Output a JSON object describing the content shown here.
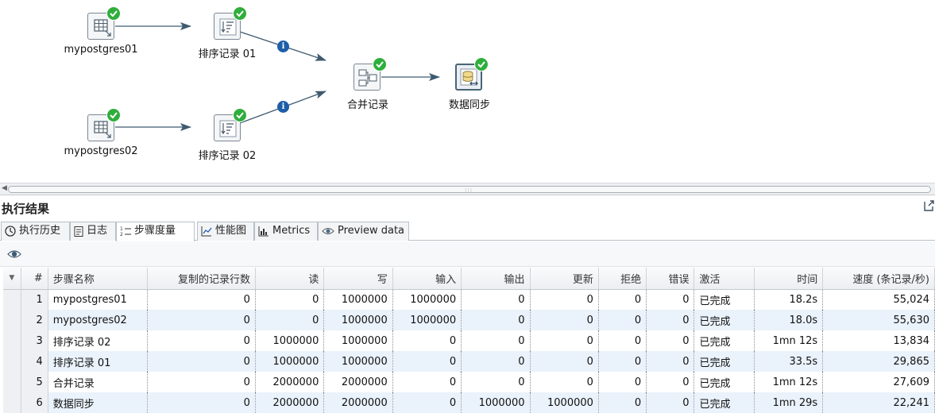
{
  "canvas": {
    "nodes": {
      "input1": {
        "label": "mypostgres01",
        "icon": "table-input-icon"
      },
      "input2": {
        "label": "mypostgres02",
        "icon": "table-input-icon"
      },
      "sort1": {
        "label": "排序记录 01",
        "icon": "sort-rows-icon"
      },
      "sort2": {
        "label": "排序记录 02",
        "icon": "sort-rows-icon"
      },
      "merge": {
        "label": "合并记录",
        "icon": "merge-rows-icon"
      },
      "sync": {
        "label": "数据同步",
        "icon": "sync-database-icon"
      }
    },
    "info_badge": "i",
    "colors": {
      "edge": "#3d5a70",
      "ok": "#2fae3c",
      "info": "#1e5ea8"
    }
  },
  "results": {
    "title": "执行结果",
    "tabs": [
      {
        "label": "执行历史",
        "icon": "history-icon"
      },
      {
        "label": "日志",
        "icon": "log-icon"
      },
      {
        "label": "步骤度量",
        "icon": "step-metrics-icon"
      },
      {
        "label": "性能图",
        "icon": "perf-graph-icon"
      },
      {
        "label": "Metrics",
        "icon": "metrics-icon"
      },
      {
        "label": "Preview data",
        "icon": "eye-icon"
      }
    ],
    "active_tab": "步骤度量",
    "table": {
      "columns": [
        "#",
        "步骤名称",
        "复制的记录行数",
        "读",
        "写",
        "输入",
        "输出",
        "更新",
        "拒绝",
        "错误",
        "激活",
        "时间",
        "速度 (条记录/秒)"
      ],
      "rows": [
        [
          "1",
          "mypostgres01",
          "0",
          "0",
          "1000000",
          "1000000",
          "0",
          "0",
          "0",
          "0",
          "已完成",
          "18.2s",
          "55,024"
        ],
        [
          "2",
          "mypostgres02",
          "0",
          "0",
          "1000000",
          "1000000",
          "0",
          "0",
          "0",
          "0",
          "已完成",
          "18.0s",
          "55,630"
        ],
        [
          "3",
          "排序记录 02",
          "0",
          "1000000",
          "1000000",
          "0",
          "0",
          "0",
          "0",
          "0",
          "已完成",
          "1mn 12s",
          "13,834"
        ],
        [
          "4",
          "排序记录 01",
          "0",
          "1000000",
          "1000000",
          "0",
          "0",
          "0",
          "0",
          "0",
          "已完成",
          "33.5s",
          "29,865"
        ],
        [
          "5",
          "合并记录",
          "0",
          "2000000",
          "2000000",
          "0",
          "0",
          "0",
          "0",
          "0",
          "已完成",
          "1mn 12s",
          "27,609"
        ],
        [
          "6",
          "数据同步",
          "0",
          "2000000",
          "2000000",
          "0",
          "1000000",
          "1000000",
          "0",
          "0",
          "已完成",
          "1mn 29s",
          "22,241"
        ]
      ]
    }
  }
}
